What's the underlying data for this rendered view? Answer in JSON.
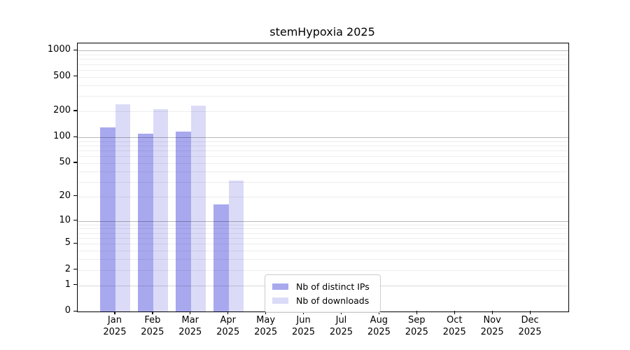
{
  "title": "stemHypoxia 2025",
  "chart_data": {
    "type": "bar",
    "title": "stemHypoxia 2025",
    "categories": [
      "Jan 2025",
      "Feb 2025",
      "Mar 2025",
      "Apr 2025",
      "May 2025",
      "Jun 2025",
      "Jul 2025",
      "Aug 2025",
      "Sep 2025",
      "Oct 2025",
      "Nov 2025",
      "Dec 2025"
    ],
    "series": [
      {
        "name": "Nb of distinct IPs",
        "color": "#a8a8ef",
        "values": [
          130,
          110,
          117,
          16,
          0,
          0,
          0,
          0,
          0,
          0,
          0,
          0
        ]
      },
      {
        "name": "Nb of downloads",
        "color": "#dbdbf8",
        "values": [
          240,
          212,
          230,
          31,
          0,
          0,
          0,
          0,
          0,
          0,
          0,
          0
        ]
      }
    ],
    "y_ticks": [
      0,
      1,
      2,
      5,
      10,
      20,
      50,
      100,
      200,
      500,
      1000
    ],
    "y_scale": "log10(1+v)",
    "ylim": [
      0,
      1200
    ],
    "grid": "horizontal major+minor",
    "legend_position": "bottom-center"
  }
}
